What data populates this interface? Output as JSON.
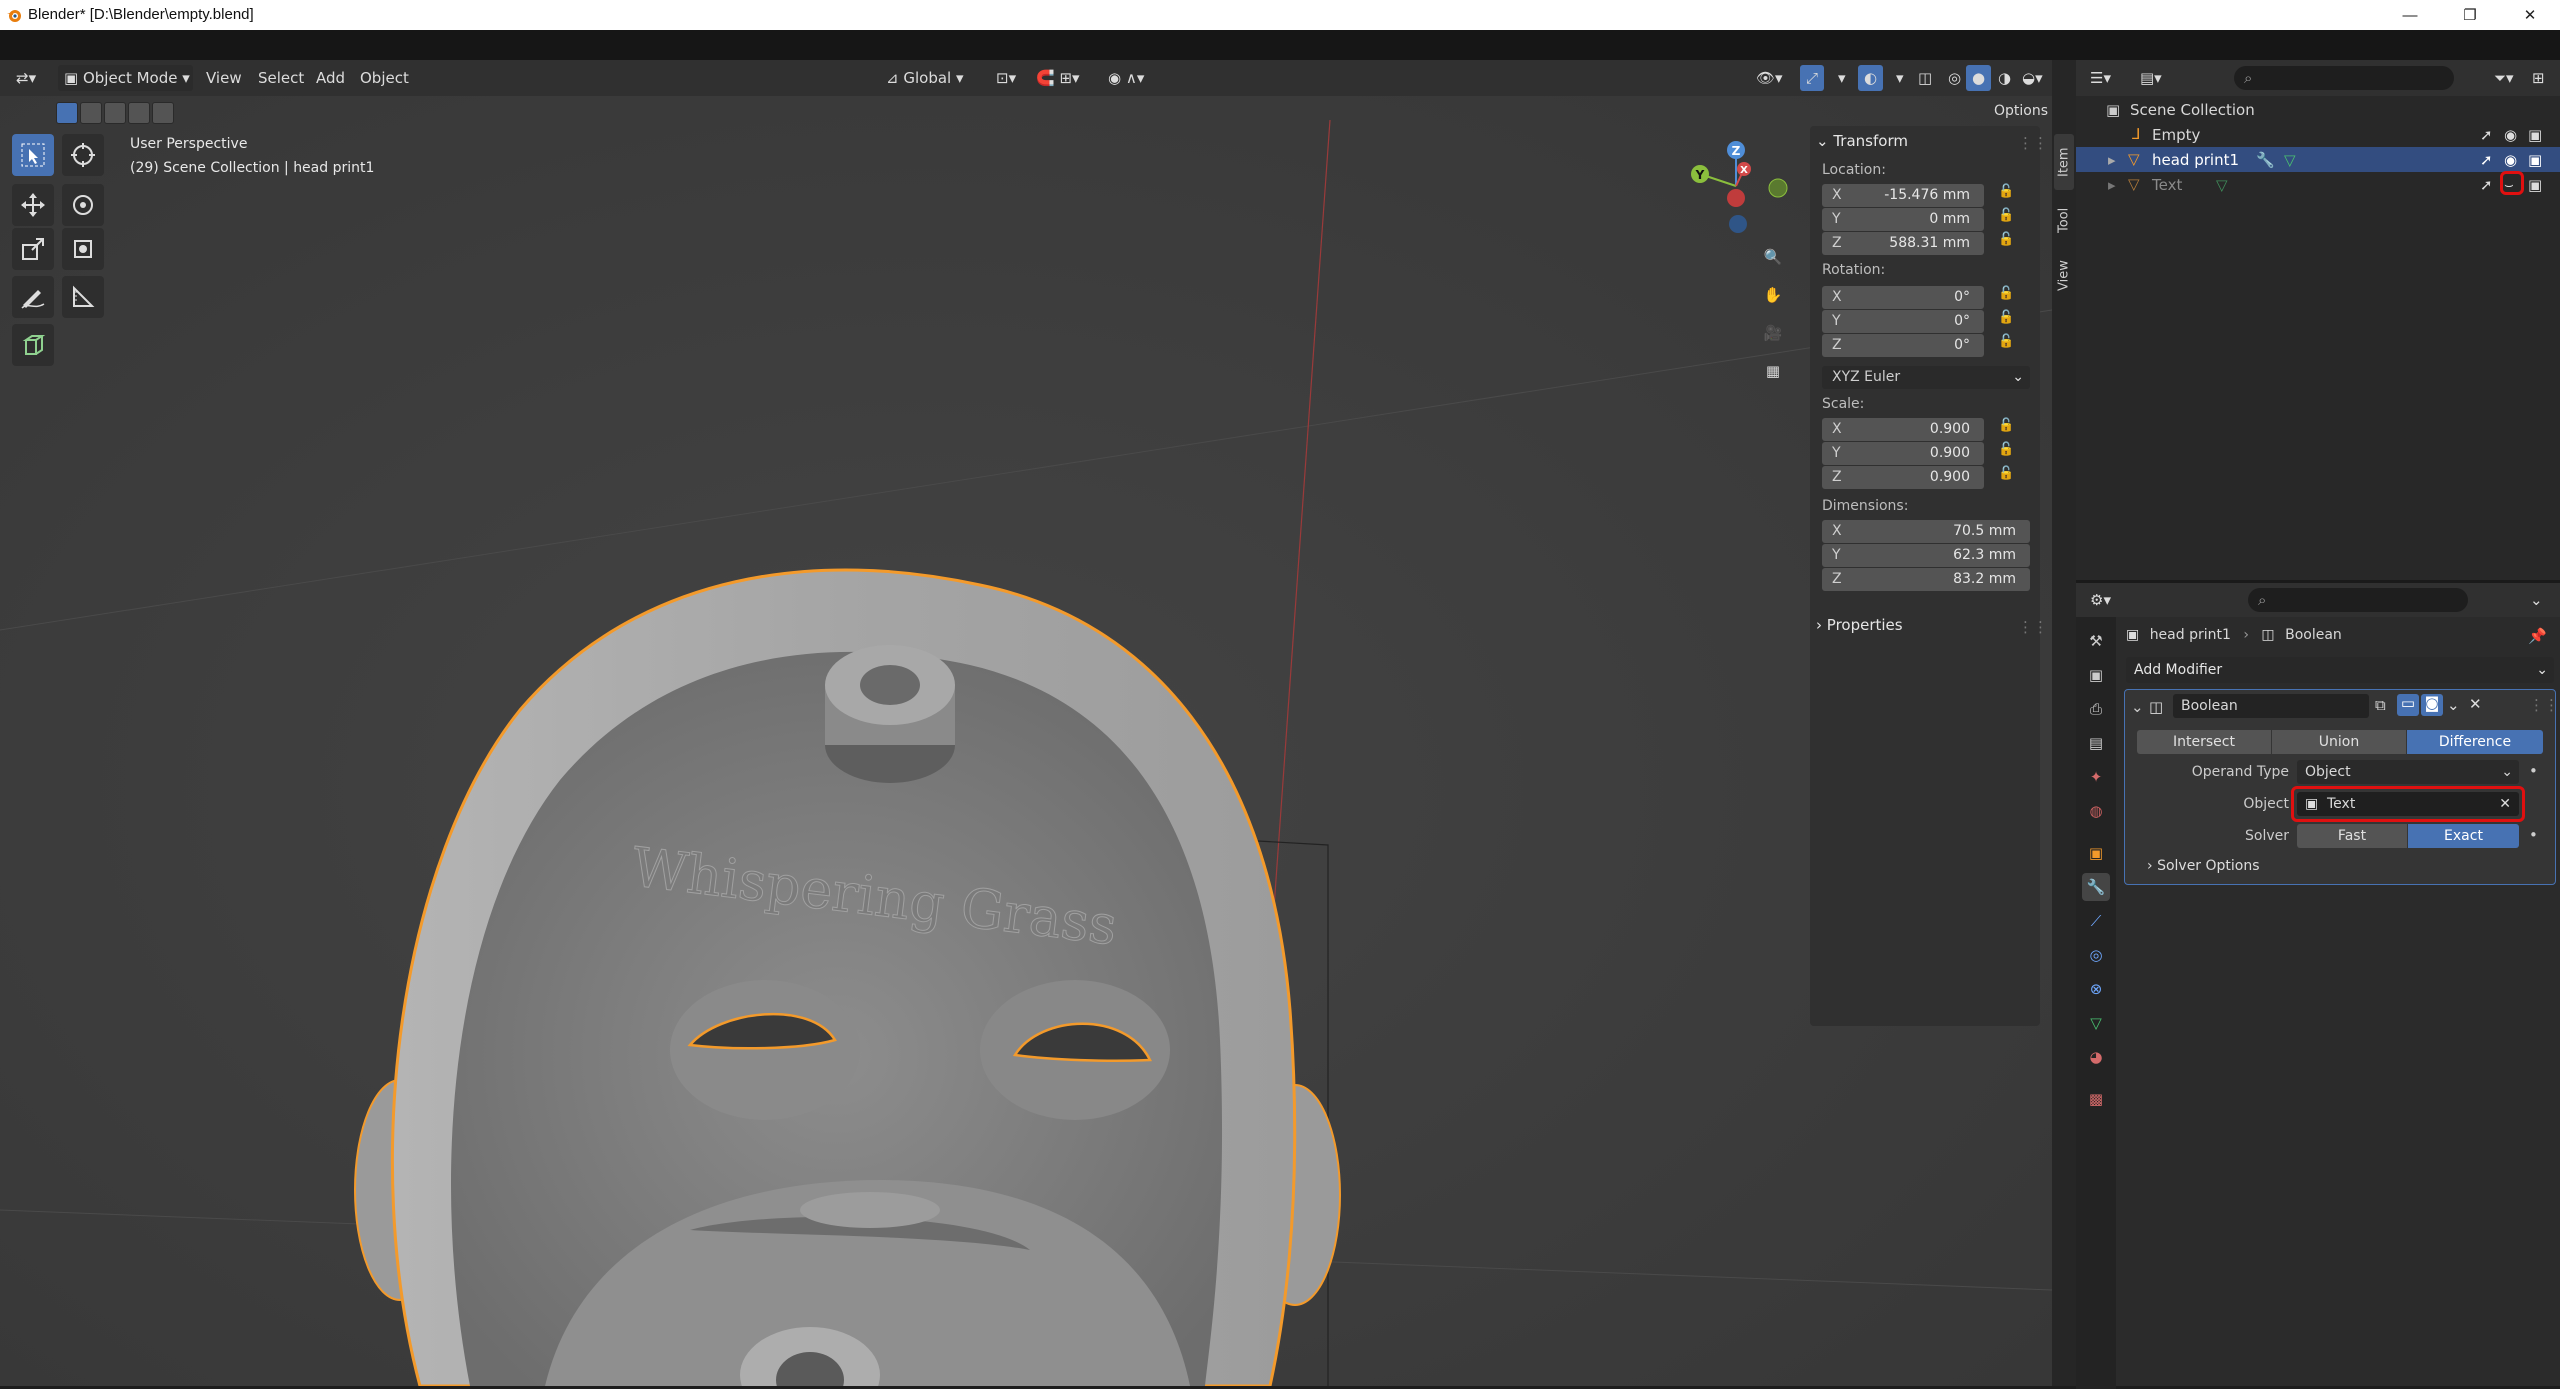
{
  "window": {
    "title": "Blender* [D:\\Blender\\empty.blend]",
    "controls": [
      "—",
      "❐",
      "✕"
    ]
  },
  "viewport": {
    "mode": "Object Mode",
    "menus": [
      "View",
      "Select",
      "Add",
      "Object"
    ],
    "orientation": "Global",
    "options_label": "Options",
    "overlay_line1": "User Perspective",
    "overlay_line2": "(29) Scene Collection | head print1",
    "engraved_text": "Whispering Grass",
    "gizmo_axes": [
      "X",
      "Y",
      "Z"
    ]
  },
  "n_panel": {
    "transform_header": "Transform",
    "location_label": "Location:",
    "location": [
      {
        "axis": "X",
        "value": "-15.476 mm"
      },
      {
        "axis": "Y",
        "value": "0 mm"
      },
      {
        "axis": "Z",
        "value": "588.31 mm"
      }
    ],
    "rotation_label": "Rotation:",
    "rotation": [
      {
        "axis": "X",
        "value": "0°"
      },
      {
        "axis": "Y",
        "value": "0°"
      },
      {
        "axis": "Z",
        "value": "0°"
      }
    ],
    "rotation_mode": "XYZ Euler",
    "scale_label": "Scale:",
    "scale": [
      {
        "axis": "X",
        "value": "0.900"
      },
      {
        "axis": "Y",
        "value": "0.900"
      },
      {
        "axis": "Z",
        "value": "0.900"
      }
    ],
    "dimensions_label": "Dimensions:",
    "dimensions": [
      {
        "axis": "X",
        "value": "70.5 mm"
      },
      {
        "axis": "Y",
        "value": "62.3 mm"
      },
      {
        "axis": "Z",
        "value": "83.2 mm"
      }
    ],
    "properties_header": "Properties",
    "tabs": [
      "Item",
      "Tool",
      "View"
    ]
  },
  "outliner": {
    "root": "Scene Collection",
    "items": [
      {
        "name": "Empty",
        "selected": false
      },
      {
        "name": "head print1",
        "selected": true
      },
      {
        "name": "Text",
        "selected": false
      }
    ]
  },
  "properties": {
    "breadcrumb_object": "head print1",
    "breadcrumb_modifier": "Boolean",
    "add_modifier": "Add Modifier",
    "modifier_name": "Boolean",
    "ops": [
      "Intersect",
      "Union",
      "Difference"
    ],
    "active_op": "Difference",
    "operand_type_label": "Operand Type",
    "operand_type": "Object",
    "object_label": "Object",
    "object_value": "Text",
    "solver_label": "Solver",
    "solvers": [
      "Fast",
      "Exact"
    ],
    "active_solver": "Exact",
    "solver_options": "Solver Options"
  },
  "colors": {
    "accent": "#4772b3",
    "selection_outline": "#f39a2b",
    "highlight_box": "#e01010"
  }
}
